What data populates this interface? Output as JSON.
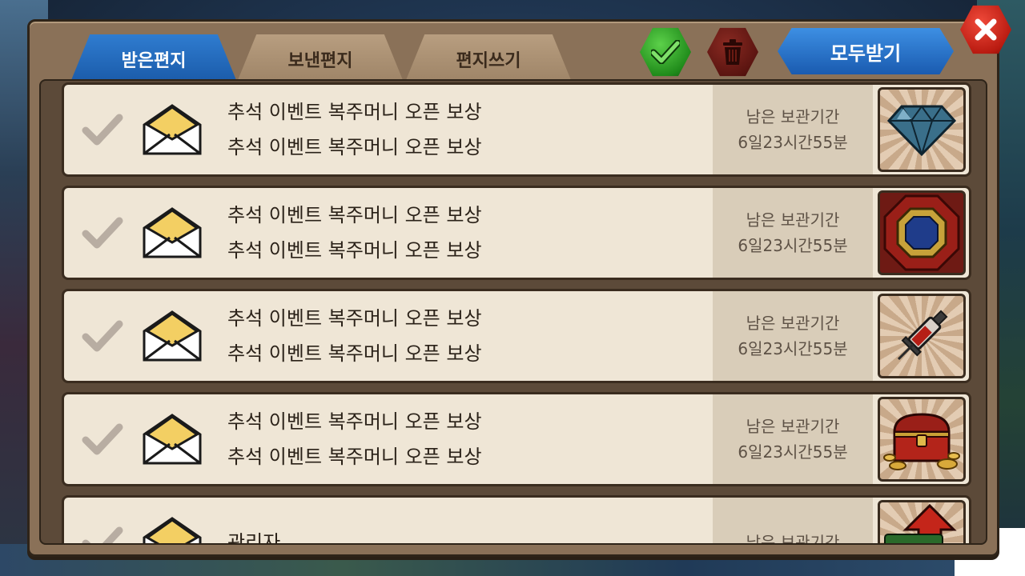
{
  "tabs": {
    "received": "받은편지",
    "sent": "보낸편지",
    "write": "편지쓰기"
  },
  "toolbar": {
    "select_all_icon": "green-check-icon",
    "delete_icon": "trash-icon",
    "receive_all_label": "모두받기",
    "close_icon": "close-x-icon"
  },
  "mails": [
    {
      "line1": "추석 이벤트 복주머니 오픈 보상",
      "line2": "추석 이벤트 복주머니 오픈 보상",
      "remaining_label": "남은 보관기간",
      "remaining_time": "6일23시간55분",
      "item_icon": "diamond-icon"
    },
    {
      "line1": "추석 이벤트 복주머니 오픈 보상",
      "line2": "추석 이벤트 복주머니 오픈 보상",
      "remaining_label": "남은 보관기간",
      "remaining_time": "6일23시간55분",
      "item_icon": "octagon-gem-icon"
    },
    {
      "line1": "추석 이벤트 복주머니 오픈 보상",
      "line2": "추석 이벤트 복주머니 오픈 보상",
      "remaining_label": "남은 보관기간",
      "remaining_time": "6일23시간55분",
      "item_icon": "syringe-icon"
    },
    {
      "line1": "추석 이벤트 복주머니 오픈 보상",
      "line2": "추석 이벤트 복주머니 오픈 보상",
      "remaining_label": "남은 보관기간",
      "remaining_time": "6일23시간55분",
      "item_icon": "treasure-chest-icon"
    },
    {
      "line1": "관리자",
      "line2": "",
      "remaining_label": "남은 보관기간",
      "remaining_time": "",
      "item_icon": "premium-level-up-icon"
    }
  ],
  "colors": {
    "tab_active": "#1a5aa8",
    "confirm_green": "#1f8a1a",
    "delete_red": "#5a1410",
    "close_red": "#b81a10",
    "row_bg": "#efe6d6"
  }
}
